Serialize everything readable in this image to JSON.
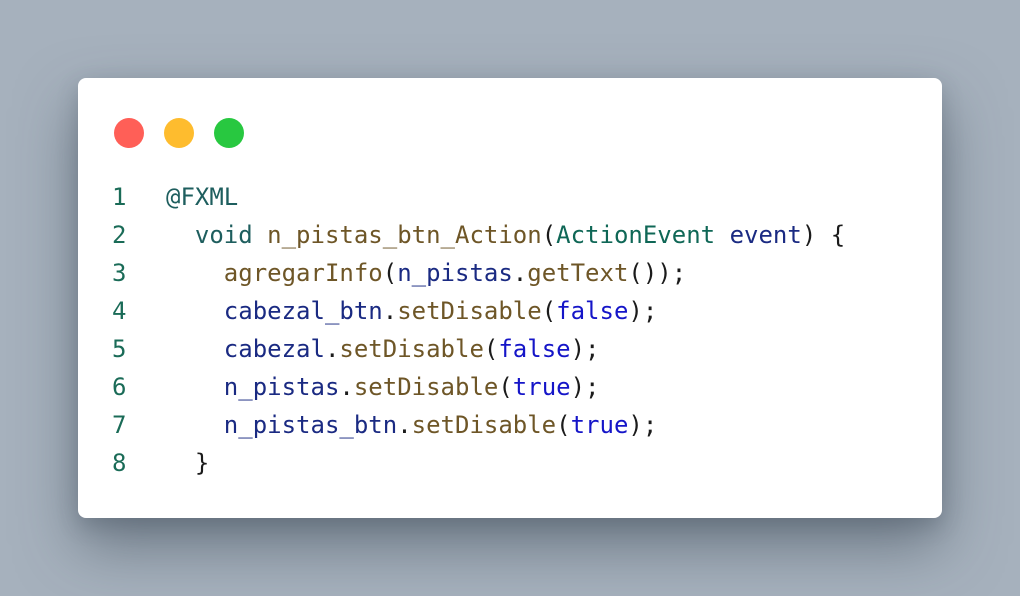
{
  "colors": {
    "background": "#a6b1bd",
    "card": "#ffffff",
    "close_dot": "#ff5f57",
    "minimize_dot": "#febc2e",
    "zoom_dot": "#28c840",
    "line_number": "#1a6b57",
    "annotation": "#1e5e5e",
    "keyword": "#1e5e5e",
    "method": "#6e5627",
    "type": "#0f6756",
    "variable": "#1a2a82",
    "literal": "#1515c8",
    "punctuation": "#1b1b1b"
  },
  "window_controls": [
    {
      "name": "close-dot",
      "color": "#ff5f57"
    },
    {
      "name": "minimize-dot",
      "color": "#febc2e"
    },
    {
      "name": "zoom-dot",
      "color": "#28c840"
    }
  ],
  "code": {
    "language": "java",
    "lines": [
      {
        "number": "1",
        "tokens": [
          {
            "text": "@FXML",
            "kind": "annotation"
          }
        ]
      },
      {
        "number": "2",
        "tokens": [
          {
            "text": "  ",
            "kind": "plain"
          },
          {
            "text": "void",
            "kind": "keyword"
          },
          {
            "text": " ",
            "kind": "plain"
          },
          {
            "text": "n_pistas_btn_Action",
            "kind": "method"
          },
          {
            "text": "(",
            "kind": "punct"
          },
          {
            "text": "ActionEvent",
            "kind": "type"
          },
          {
            "text": " ",
            "kind": "plain"
          },
          {
            "text": "event",
            "kind": "variable"
          },
          {
            "text": ") {",
            "kind": "punct"
          }
        ]
      },
      {
        "number": "3",
        "tokens": [
          {
            "text": "    ",
            "kind": "plain"
          },
          {
            "text": "agregarInfo",
            "kind": "method"
          },
          {
            "text": "(",
            "kind": "punct"
          },
          {
            "text": "n_pistas",
            "kind": "variable"
          },
          {
            "text": ".",
            "kind": "punct"
          },
          {
            "text": "getText",
            "kind": "method"
          },
          {
            "text": "());",
            "kind": "punct"
          }
        ]
      },
      {
        "number": "4",
        "tokens": [
          {
            "text": "    ",
            "kind": "plain"
          },
          {
            "text": "cabezal_btn",
            "kind": "variable"
          },
          {
            "text": ".",
            "kind": "punct"
          },
          {
            "text": "setDisable",
            "kind": "method"
          },
          {
            "text": "(",
            "kind": "punct"
          },
          {
            "text": "false",
            "kind": "literal"
          },
          {
            "text": ");",
            "kind": "punct"
          }
        ]
      },
      {
        "number": "5",
        "tokens": [
          {
            "text": "    ",
            "kind": "plain"
          },
          {
            "text": "cabezal",
            "kind": "variable"
          },
          {
            "text": ".",
            "kind": "punct"
          },
          {
            "text": "setDisable",
            "kind": "method"
          },
          {
            "text": "(",
            "kind": "punct"
          },
          {
            "text": "false",
            "kind": "literal"
          },
          {
            "text": ");",
            "kind": "punct"
          }
        ]
      },
      {
        "number": "6",
        "tokens": [
          {
            "text": "    ",
            "kind": "plain"
          },
          {
            "text": "n_pistas",
            "kind": "variable"
          },
          {
            "text": ".",
            "kind": "punct"
          },
          {
            "text": "setDisable",
            "kind": "method"
          },
          {
            "text": "(",
            "kind": "punct"
          },
          {
            "text": "true",
            "kind": "literal"
          },
          {
            "text": ");",
            "kind": "punct"
          }
        ]
      },
      {
        "number": "7",
        "tokens": [
          {
            "text": "    ",
            "kind": "plain"
          },
          {
            "text": "n_pistas_btn",
            "kind": "variable"
          },
          {
            "text": ".",
            "kind": "punct"
          },
          {
            "text": "setDisable",
            "kind": "method"
          },
          {
            "text": "(",
            "kind": "punct"
          },
          {
            "text": "true",
            "kind": "literal"
          },
          {
            "text": ");",
            "kind": "punct"
          }
        ]
      },
      {
        "number": "8",
        "tokens": [
          {
            "text": "  ",
            "kind": "plain"
          },
          {
            "text": "}",
            "kind": "punct"
          }
        ]
      }
    ]
  }
}
